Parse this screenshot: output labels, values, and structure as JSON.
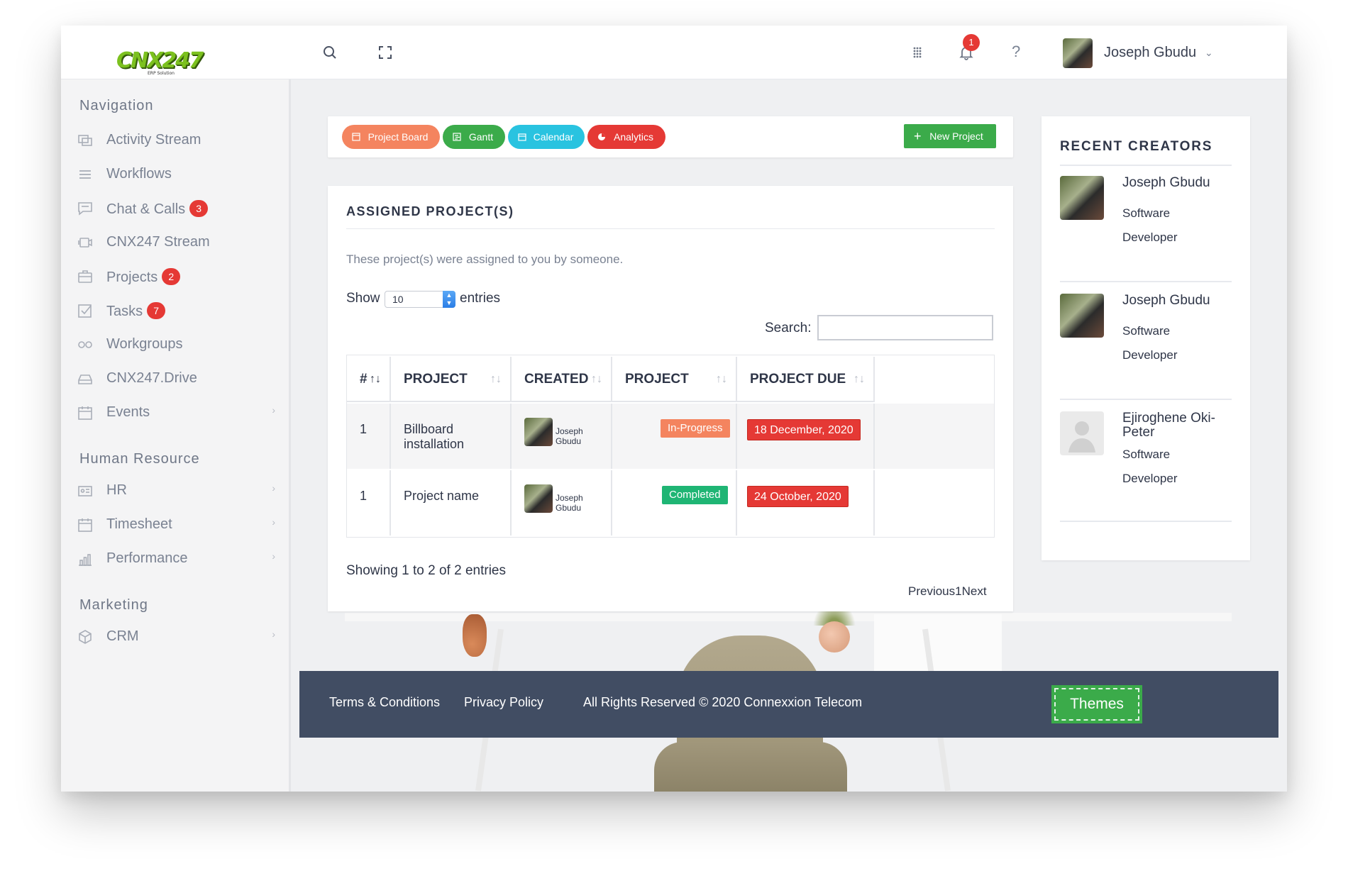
{
  "topbar": {
    "user_name": "Joseph Gbudu",
    "notification_count": "1",
    "help_glyph": "?",
    "icons": [
      "search-icon",
      "fullscreen-icon",
      "apps-grid-icon",
      "bell-icon",
      "chevron-down-icon"
    ]
  },
  "logo": {
    "text": "CNX247",
    "tagline": "ERP Solution"
  },
  "sidebar": {
    "sections": [
      {
        "title": "Navigation",
        "items": [
          {
            "label": "Activity Stream",
            "icon": "activity-stream-icon",
            "badge": null
          },
          {
            "label": "Workflows",
            "icon": "menu-lines-icon",
            "badge": null
          },
          {
            "label": "Chat & Calls",
            "icon": "chat-bubble-icon",
            "badge": "3"
          },
          {
            "label": "CNX247 Stream",
            "icon": "video-camera-icon",
            "badge": null
          },
          {
            "label": "Projects",
            "icon": "briefcase-icon",
            "badge": "2"
          },
          {
            "label": "Tasks",
            "icon": "checkbox-icon",
            "badge": "7"
          },
          {
            "label": "Workgroups",
            "icon": "infinity-icon",
            "badge": null
          },
          {
            "label": "CNX247.Drive",
            "icon": "drive-icon",
            "badge": null
          },
          {
            "label": "Events",
            "icon": "calendar-icon",
            "badge": null,
            "expandable": true
          }
        ]
      },
      {
        "title": "Human Resource",
        "items": [
          {
            "label": "HR",
            "icon": "id-card-icon",
            "badge": null,
            "expandable": true
          },
          {
            "label": "Timesheet",
            "icon": "calendar-icon",
            "badge": null,
            "expandable": true
          },
          {
            "label": "Performance",
            "icon": "bar-chart-icon",
            "badge": null,
            "expandable": true
          }
        ]
      },
      {
        "title": "Marketing",
        "items": [
          {
            "label": "CRM",
            "icon": "cube-icon",
            "badge": null,
            "expandable": true
          }
        ]
      }
    ]
  },
  "toolbar": {
    "tabs": [
      {
        "label": "Project Board",
        "color": "#f4845f",
        "icon": "board-icon"
      },
      {
        "label": "Gantt",
        "color": "#3bab4a",
        "icon": "gantt-icon"
      },
      {
        "label": "Calendar",
        "color": "#29c3e0",
        "icon": "calendar-icon"
      },
      {
        "label": "Analytics",
        "color": "#e53935",
        "icon": "pie-chart-icon"
      }
    ],
    "new_project_label": "New Project"
  },
  "projects": {
    "title": "ASSIGNED PROJECT(S)",
    "description": "These project(s) were assigned to you by someone.",
    "show_label": "Show",
    "entries_value": "10",
    "entries_label": "entries",
    "search_label": "Search:",
    "search_value": "",
    "columns": [
      "#",
      "PROJECT",
      "CREATED BY",
      "PROJECT STATUS",
      "PROJECT DUE DATE"
    ],
    "rows": [
      {
        "num": "1",
        "project": "Billboard installation",
        "created_by": "Joseph Gbudu",
        "status": "In-Progress",
        "status_color": "#f4845f",
        "due_date": "18 December, 2020"
      },
      {
        "num": "1",
        "project": "Project name",
        "created_by": "Joseph Gbudu",
        "status": "Completed",
        "status_color": "#1fb574",
        "due_date": "24 October, 2020"
      }
    ],
    "showing_text": "Showing 1 to 2 of 2 entries",
    "pager": {
      "previous": "Previous",
      "page": "1",
      "next": "Next"
    }
  },
  "creators": {
    "title": "RECENT CREATORS",
    "list": [
      {
        "name": "Joseph Gbudu",
        "role": "Software Developer",
        "has_photo": true
      },
      {
        "name": "Joseph Gbudu",
        "role": "Software Developer",
        "has_photo": true
      },
      {
        "name": "Ejiroghene Oki-Peter",
        "role": "Software Developer",
        "has_photo": false
      }
    ]
  },
  "footer": {
    "links": [
      "Terms & Conditions",
      "Privacy Policy",
      "All Rights Reserved © 2020 Connexxion Telecom"
    ],
    "themes_label": "Themes"
  }
}
